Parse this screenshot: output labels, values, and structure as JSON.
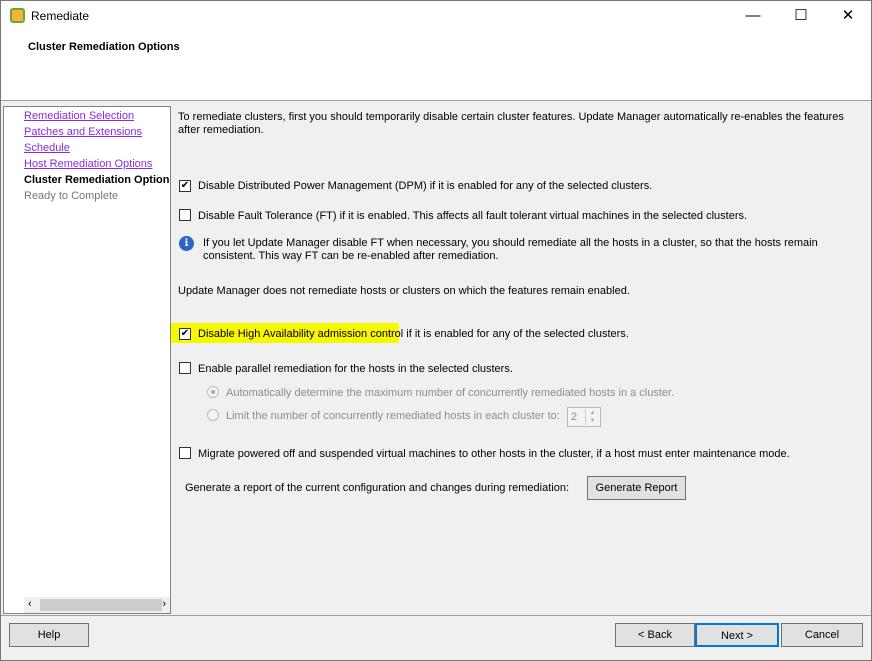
{
  "window": {
    "title": "Remediate",
    "minimize": "—",
    "maximize": "☐",
    "close": "✕"
  },
  "header": {
    "title": "Cluster Remediation Options"
  },
  "nav": {
    "items": [
      {
        "label": "Remediation Selection",
        "state": "link"
      },
      {
        "label": "Patches and Extensions",
        "state": "link"
      },
      {
        "label": "Schedule",
        "state": "link"
      },
      {
        "label": "Host Remediation Options",
        "state": "link"
      },
      {
        "label": "Cluster Remediation Options",
        "state": "current"
      },
      {
        "label": "Ready to Complete",
        "state": "disabled"
      }
    ],
    "scroll_left": "‹",
    "scroll_right": "›"
  },
  "main": {
    "intro": "To remediate clusters, first you should temporarily disable certain cluster features. Update Manager automatically re-enables the features",
    "intro2": "after remediation.",
    "dpm": {
      "label": "Disable Distributed Power Management (DPM) if it is enabled for any of the selected clusters.",
      "checked": true
    },
    "ft": {
      "label": "Disable Fault Tolerance (FT) if it is enabled. This affects all fault tolerant virtual machines in the selected clusters.",
      "checked": false
    },
    "ft_info1": "If you let Update Manager disable FT when necessary, you should remediate all the hosts in a cluster, so that the hosts remain",
    "ft_info2": "consistent. This way FT can be re-enabled after remediation.",
    "note": "Update Manager does not remediate hosts or clusters on which the features remain enabled.",
    "ha": {
      "label_hl": "Disable High Availability admission control",
      "label_rest": " if it is enabled for any of the selected clusters.",
      "checked": true
    },
    "parallel": {
      "label": "Enable parallel remediation for the hosts in the selected clusters.",
      "checked": false
    },
    "auto": {
      "label": "Automatically determine the maximum number of concurrently remediated hosts in a cluster.",
      "selected": true
    },
    "limit": {
      "label": "Limit the number of concurrently remediated hosts in each cluster to:",
      "selected": false,
      "value": "2"
    },
    "migrate": {
      "label": "Migrate powered off and suspended virtual machines to other hosts in the cluster, if a host must enter maintenance mode.",
      "checked": false
    },
    "report_label": "Generate a report of the current configuration and changes during remediation:",
    "report_button": "Generate Report"
  },
  "footer": {
    "help": "Help",
    "back": "< Back",
    "next": "Next >",
    "cancel": "Cancel"
  }
}
